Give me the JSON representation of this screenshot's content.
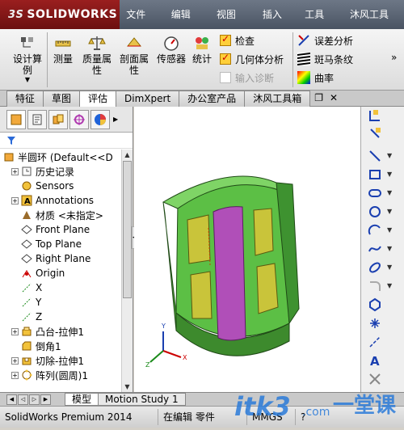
{
  "app": {
    "brand": "SOLIDWORKS",
    "menus": [
      "文件(F)",
      "编辑(E)",
      "视图(V)",
      "插入(I)",
      "工具(T)",
      "沐风工具箱"
    ]
  },
  "toolbar": {
    "design_study": "设计算例",
    "measure": "测量",
    "mass_props": "质量属性",
    "section_props": "剖面属性",
    "sensor": "传感器",
    "statistics": "统计",
    "check": "检查",
    "geometry_analysis": "几何体分析",
    "import_diagnostics": "输入诊断",
    "deviation_analysis": "误差分析",
    "zebra_stripes": "斑马条纹",
    "curvature": "曲率"
  },
  "tabs": [
    "特征",
    "草图",
    "评估",
    "DimXpert",
    "办公室产品",
    "沐风工具箱"
  ],
  "active_tab": "评估",
  "tree": {
    "root": "半圆环  (Default<<D",
    "items": [
      {
        "label": "历史记录",
        "expand": true,
        "icon": "history"
      },
      {
        "label": "Sensors",
        "expand": false,
        "icon": "sensor"
      },
      {
        "label": "Annotations",
        "expand": true,
        "icon": "annotation"
      },
      {
        "label": "材质 <未指定>",
        "expand": false,
        "icon": "material"
      },
      {
        "label": "Front Plane",
        "expand": false,
        "icon": "plane"
      },
      {
        "label": "Top Plane",
        "expand": false,
        "icon": "plane"
      },
      {
        "label": "Right Plane",
        "expand": false,
        "icon": "plane"
      },
      {
        "label": "Origin",
        "expand": false,
        "icon": "origin"
      },
      {
        "label": "X",
        "expand": false,
        "icon": "axis"
      },
      {
        "label": "Y",
        "expand": false,
        "icon": "axis"
      },
      {
        "label": "Z",
        "expand": false,
        "icon": "axis"
      },
      {
        "label": "凸台-拉伸1",
        "expand": true,
        "icon": "extrude"
      },
      {
        "label": "倒角1",
        "expand": false,
        "icon": "chamfer"
      },
      {
        "label": "切除-拉伸1",
        "expand": true,
        "icon": "cut"
      },
      {
        "label": "阵列(圆周)1",
        "expand": true,
        "icon": "pattern"
      }
    ]
  },
  "bottom_tabs": [
    "模型",
    "Motion Study 1"
  ],
  "status": {
    "product": "SolidWorks Premium 2014",
    "mode": "在编辑 零件",
    "units": "MMGS"
  },
  "watermark": {
    "site": "itk3",
    "domain": ".com",
    "tagline": "一堂课"
  },
  "colors": {
    "accent_red": "#8a1616",
    "part_green": "#4fa63a",
    "slot_yellow": "#c9c43a",
    "inner_purple": "#b04fb8"
  }
}
